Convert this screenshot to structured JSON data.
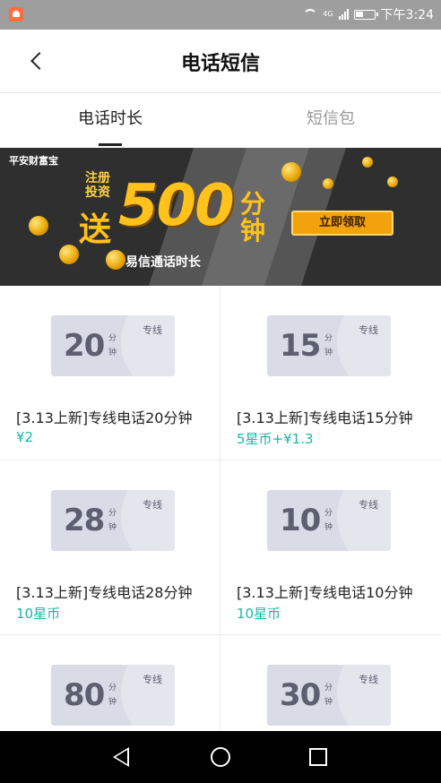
{
  "statusbar": {
    "network": "4G",
    "time": "下午3:24",
    "icons": [
      "app-icon",
      "wifi-icon",
      "signal-icon",
      "battery-icon"
    ]
  },
  "header": {
    "title": "电话短信",
    "back_icon": "chevron-left-icon"
  },
  "tabs": [
    {
      "label": "电话时长",
      "active": true
    },
    {
      "label": "短信包",
      "active": false
    }
  ],
  "banner": {
    "brand": "平安财富宝",
    "line1": "注册",
    "line2": "投资",
    "send": "送",
    "amount": "500",
    "unit1": "分",
    "unit2": "钟",
    "desc": "易信通话时长",
    "cta": "立即领取",
    "accent_color": "#ffc21a"
  },
  "products": [
    {
      "minutes": "20",
      "fen": "分",
      "zhong": "钟",
      "line_label": "专线",
      "name": "[3.13上新]专线电话20分钟",
      "price": "¥2"
    },
    {
      "minutes": "15",
      "fen": "分",
      "zhong": "钟",
      "line_label": "专线",
      "name": "[3.13上新]专线电话15分钟",
      "price": "5星币+¥1.3"
    },
    {
      "minutes": "28",
      "fen": "分",
      "zhong": "钟",
      "line_label": "专线",
      "name": "[3.13上新]专线电话28分钟",
      "price": "10星币"
    },
    {
      "minutes": "10",
      "fen": "分",
      "zhong": "钟",
      "line_label": "专线",
      "name": "[3.13上新]专线电话10分钟",
      "price": "10星币"
    },
    {
      "minutes": "80",
      "fen": "分",
      "zhong": "钟",
      "line_label": "专线",
      "name": "",
      "price": ""
    },
    {
      "minutes": "30",
      "fen": "分",
      "zhong": "钟",
      "line_label": "专线",
      "name": "",
      "price": ""
    }
  ],
  "colors": {
    "price": "#1bb5a6",
    "card": "#d9dce6",
    "statusbar": "#9e9e9e"
  },
  "navbar": {
    "icons": [
      "nav-back-icon",
      "nav-home-icon",
      "nav-recent-icon"
    ]
  }
}
